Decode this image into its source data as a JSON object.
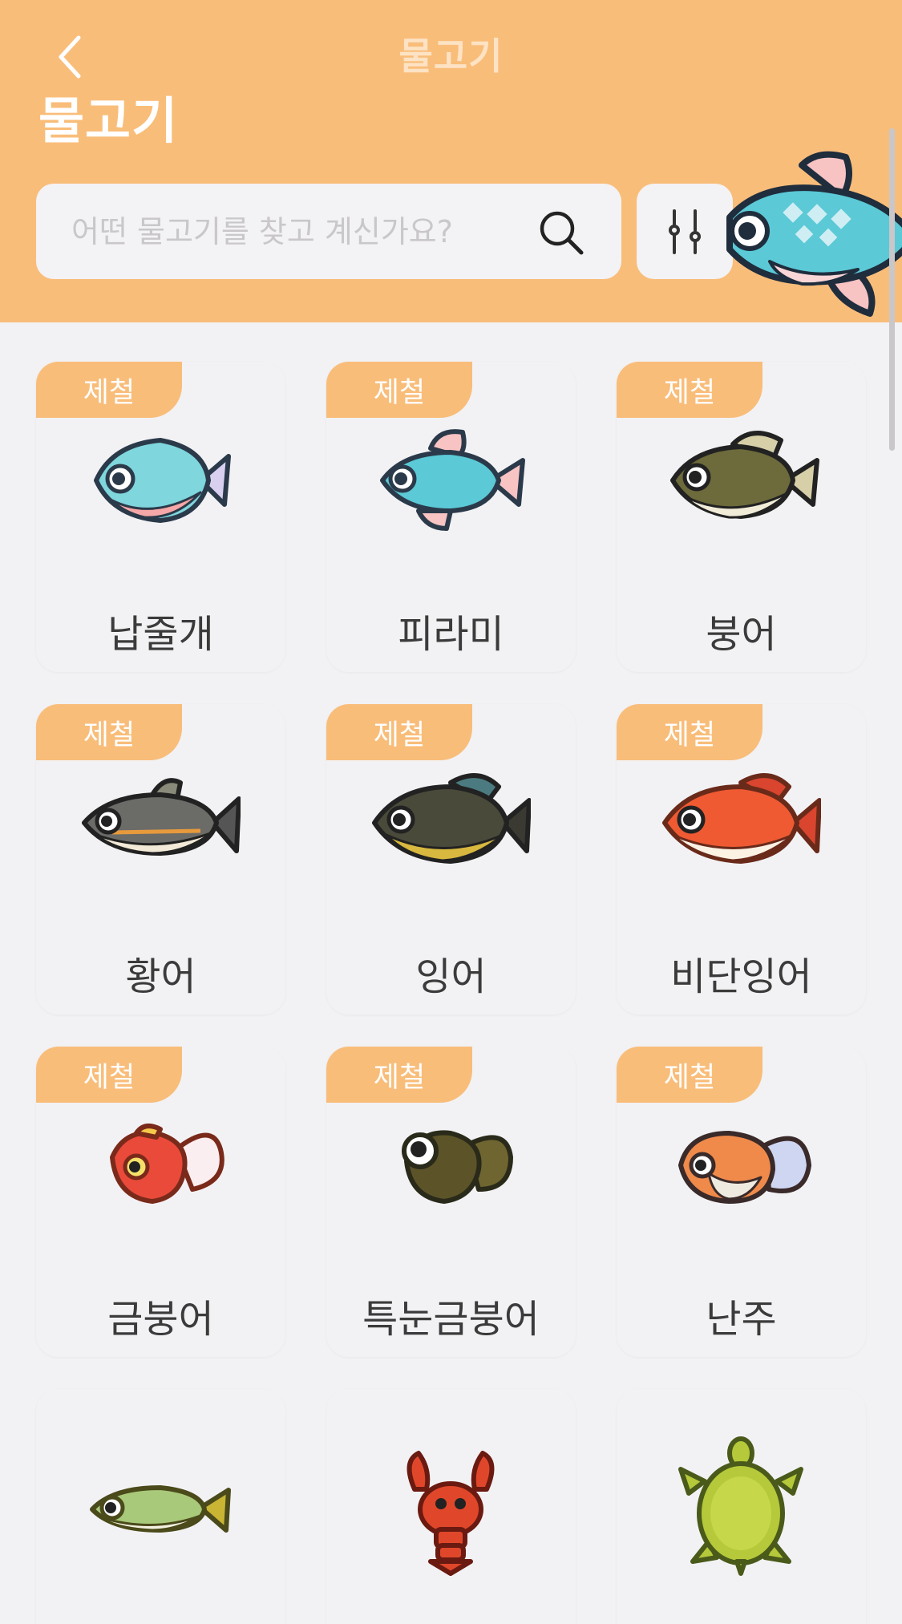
{
  "header": {
    "nav_title": "물고기",
    "page_title": "물고기",
    "search_placeholder": "어떤 물고기를 찾고 계신가요?"
  },
  "colors": {
    "accent": "#f9bd7a",
    "background": "#f2f1f3",
    "card": "#f2f2f4",
    "text": "#3b3b3b"
  },
  "cards": [
    {
      "name": "납줄개",
      "badge": "제철",
      "icon": "bitterling-fish-icon"
    },
    {
      "name": "피라미",
      "badge": "제철",
      "icon": "pale-chub-fish-icon"
    },
    {
      "name": "붕어",
      "badge": "제철",
      "icon": "crucian-carp-fish-icon"
    },
    {
      "name": "황어",
      "badge": "제철",
      "icon": "dace-fish-icon"
    },
    {
      "name": "잉어",
      "badge": "제철",
      "icon": "carp-fish-icon"
    },
    {
      "name": "비단잉어",
      "badge": "제철",
      "icon": "koi-fish-icon"
    },
    {
      "name": "금붕어",
      "badge": "제철",
      "icon": "goldfish-icon"
    },
    {
      "name": "특눈금붕어",
      "badge": "제철",
      "icon": "pop-eyed-goldfish-icon"
    },
    {
      "name": "난주",
      "badge": "제철",
      "icon": "ranchu-goldfish-icon"
    },
    {
      "name": "",
      "badge": "",
      "icon": "killifish-icon"
    },
    {
      "name": "",
      "badge": "",
      "icon": "crawfish-icon"
    },
    {
      "name": "",
      "badge": "",
      "icon": "soft-shelled-turtle-icon"
    }
  ]
}
